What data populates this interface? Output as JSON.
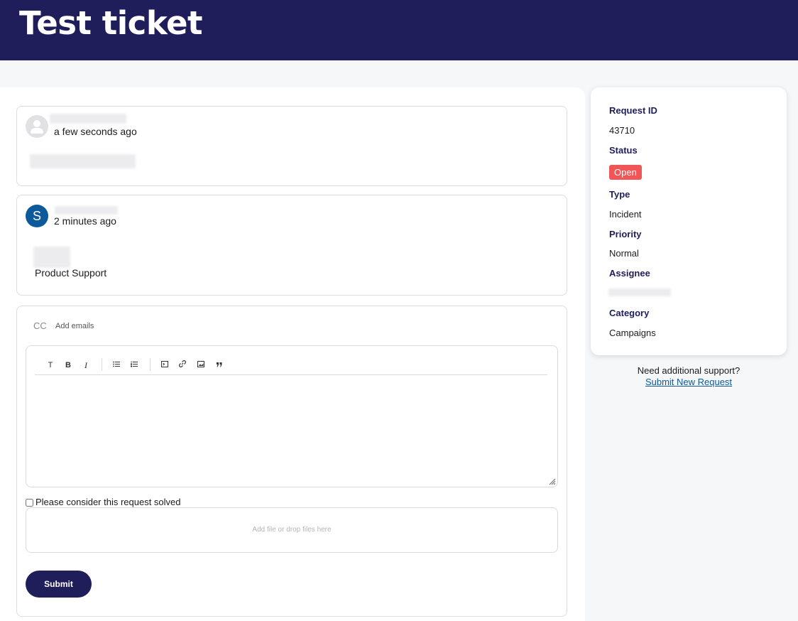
{
  "page": {
    "title": "Test ticket"
  },
  "comments": [
    {
      "time": "a few seconds ago",
      "avatar_icon": "default-user-icon"
    },
    {
      "time": "2 minutes ago",
      "avatar_initial": "S",
      "avatar_color": "#0d5a9a",
      "organization": "Product Support"
    }
  ],
  "reply": {
    "cc_label": "CC",
    "cc_placeholder": "Add emails",
    "toolbar": {
      "text_label": "T",
      "bold_label": "B",
      "italic_label": "I"
    },
    "solved_label": "Please consider this request solved",
    "solved_checked": false,
    "dropzone_text": "Add file or drop files here",
    "submit_label": "Submit"
  },
  "details": {
    "request_id_label": "Request ID",
    "request_id": "43710",
    "status_label": "Status",
    "status": "Open",
    "status_color": "#f25555",
    "type_label": "Type",
    "type": "Incident",
    "priority_label": "Priority",
    "priority": "Normal",
    "assignee_label": "Assignee",
    "category_label": "Category",
    "category": "Campaigns"
  },
  "support": {
    "prompt": "Need additional support?",
    "link_label": "Submit New Request"
  },
  "colors": {
    "brand": "#1f1d5a",
    "link": "#0d5a9a"
  }
}
